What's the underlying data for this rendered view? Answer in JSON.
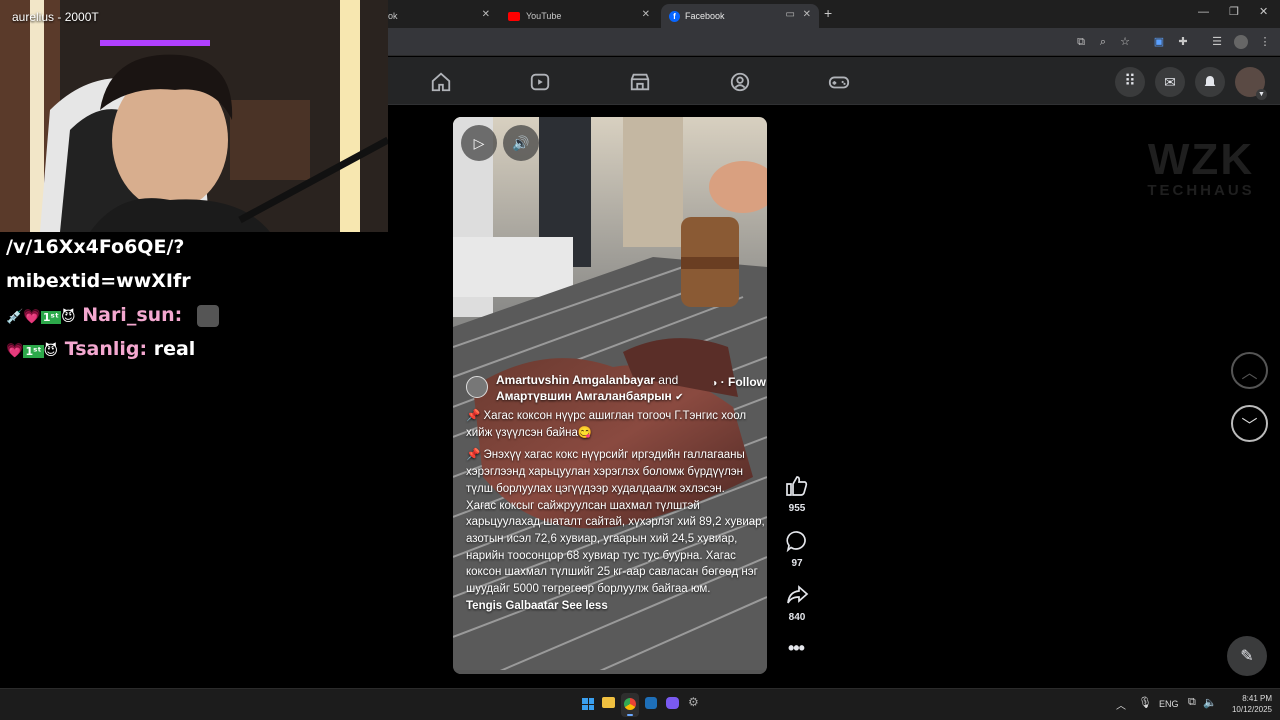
{
  "browser": {
    "tabs": [
      {
        "label": "ok",
        "active": false
      },
      {
        "label": "YouTube",
        "active": false
      },
      {
        "label": "Facebook",
        "active": true
      }
    ],
    "new_tab_label": "+"
  },
  "stream": {
    "streamer_label": "aurelius - 2000T",
    "chat_lines": [
      {
        "text": "/v/16Xx4Fo6QE/?"
      },
      {
        "text": "mibextid=wwXIfr"
      },
      {
        "user": "Nari_sun:",
        "message": ""
      },
      {
        "user": "Tsanlig:",
        "message": "real"
      }
    ]
  },
  "watermark": {
    "line1": "WZK",
    "line2": "TECHHAUS"
  },
  "reel": {
    "authors": "Amartuvshin Amgalanbayar",
    "and_text": "and",
    "coauthor": "Амартүвшин Амгаланбаярын",
    "follow_label": "· Follow",
    "paragraphs": [
      "📌 Хагас коксон нүүрс ашиглан тогооч Г.Тэнгис хоол хийж үзүүлсэн байна😋",
      "📌 Энэхүү хагас кокс нүүрсийг иргэдийн гал­лагааны хэрэглээнд харьцуулан хэрэглэх боломж бүрдүүлэн түлш борлуулах цэгүүдээр худалдаалж эхлэсэн.",
      "Хагас коксыг сайжруулсан шахмал түлштэй харьцуулахад шаталт сайтай, хүхэрлэг хий 89,2 хувиар, азотын исэл 72,6 хувиар, угаарын хий 24,5 хувиар, нарийн тоосонцор 68 хувиар тус тус буурна. Хагас коксон шахмал түлшийг 25 кг-аар савласан бөгөөд нэг шуудайг 5000 төгрөгөөр борлуулж байгаа юм."
    ],
    "tag_name": "Tengis Galbaatar",
    "see_less": "See less",
    "likes": "955",
    "comments": "97",
    "shares": "840"
  },
  "taskbar": {
    "lang": "ENG",
    "time": "8:41 PM",
    "date": "10/12/2025"
  },
  "colors": {
    "fb_blue": "#0866ff",
    "chrome_bg": "#1f1f1f",
    "fb_header": "#242526",
    "youtube_red": "#ff0000"
  }
}
